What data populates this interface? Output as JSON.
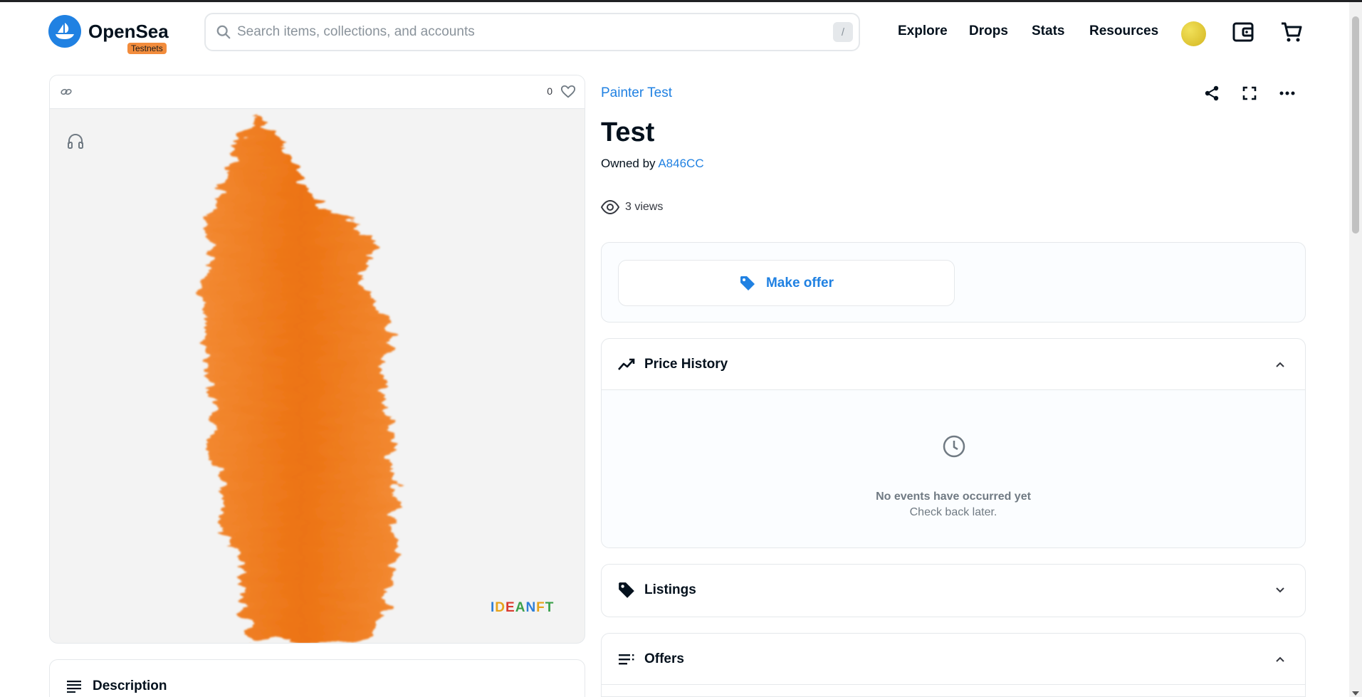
{
  "header": {
    "brand": "OpenSea",
    "badge": "Testnets",
    "search_placeholder": "Search items, collections, and accounts",
    "search_shortcut": "/",
    "nav": [
      "Explore",
      "Drops",
      "Stats",
      "Resources"
    ],
    "icons": [
      "opensea-logo-icon",
      "search-icon",
      "avatar",
      "wallet-icon",
      "cart-icon"
    ]
  },
  "media": {
    "favorites_count": "0",
    "watermark": "IDEANFT",
    "icons": [
      "chain-icon",
      "heart-icon",
      "headphones-icon"
    ]
  },
  "description": {
    "title": "Description"
  },
  "item": {
    "collection": "Painter Test",
    "title": "Test",
    "owned_by_label": "Owned by",
    "owner": "A846CC",
    "views": "3 views",
    "actions": [
      "share-icon",
      "fullscreen-icon",
      "more-icon"
    ]
  },
  "offer": {
    "make_offer_label": "Make offer"
  },
  "panels": {
    "price_history": {
      "title": "Price History",
      "empty_title": "No events have occurred yet",
      "empty_sub": "Check back later."
    },
    "listings": {
      "title": "Listings"
    },
    "offers": {
      "title": "Offers"
    }
  },
  "colors": {
    "accent": "#2081e2",
    "badge": "#f28c3c",
    "artwork": "#f07a1a",
    "text": "#04111d",
    "muted": "#707a83"
  }
}
